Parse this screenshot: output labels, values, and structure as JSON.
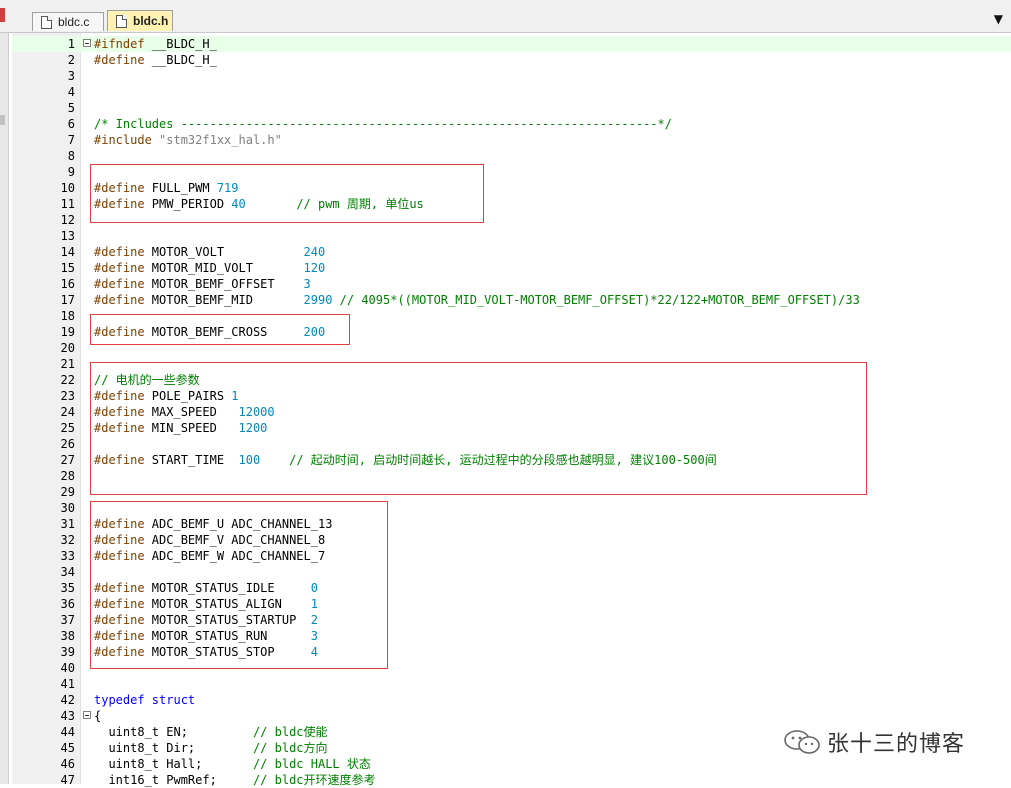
{
  "tabs": [
    {
      "label": "bldc.c",
      "active": false
    },
    {
      "label": "bldc.h",
      "active": true
    }
  ],
  "dropdown_glyph": "▼",
  "lines": [
    {
      "n": "1",
      "fold": true,
      "cur": true,
      "parts": [
        [
          "pp",
          "#ifndef "
        ],
        [
          "tp",
          "__BLDC_H_"
        ]
      ]
    },
    {
      "n": "2",
      "parts": [
        [
          "pp",
          "#define "
        ],
        [
          "tp",
          "__BLDC_H_"
        ]
      ]
    },
    {
      "n": "3",
      "parts": []
    },
    {
      "n": "4",
      "parts": []
    },
    {
      "n": "5",
      "parts": []
    },
    {
      "n": "6",
      "parts": [
        [
          "cm",
          "/* Includes ------------------------------------------------------------------*/"
        ]
      ]
    },
    {
      "n": "7",
      "parts": [
        [
          "pp",
          "#include "
        ],
        [
          "st",
          "\"stm32f1xx_hal.h\""
        ]
      ]
    },
    {
      "n": "8",
      "parts": []
    },
    {
      "n": "9",
      "parts": []
    },
    {
      "n": "10",
      "parts": [
        [
          "pp",
          "#define "
        ],
        [
          "tp",
          "FULL_PWM "
        ],
        [
          "nm",
          "719"
        ]
      ]
    },
    {
      "n": "11",
      "parts": [
        [
          "pp",
          "#define "
        ],
        [
          "tp",
          "PMW_PERIOD "
        ],
        [
          "nm",
          "40"
        ],
        [
          "tp",
          "       "
        ],
        [
          "cm",
          "// pwm 周期, 单位us"
        ]
      ]
    },
    {
      "n": "12",
      "parts": []
    },
    {
      "n": "13",
      "parts": []
    },
    {
      "n": "14",
      "parts": [
        [
          "pp",
          "#define "
        ],
        [
          "tp",
          "MOTOR_VOLT           "
        ],
        [
          "nm",
          "240"
        ]
      ]
    },
    {
      "n": "15",
      "parts": [
        [
          "pp",
          "#define "
        ],
        [
          "tp",
          "MOTOR_MID_VOLT       "
        ],
        [
          "nm",
          "120"
        ]
      ]
    },
    {
      "n": "16",
      "parts": [
        [
          "pp",
          "#define "
        ],
        [
          "tp",
          "MOTOR_BEMF_OFFSET    "
        ],
        [
          "nm",
          "3"
        ]
      ]
    },
    {
      "n": "17",
      "parts": [
        [
          "pp",
          "#define "
        ],
        [
          "tp",
          "MOTOR_BEMF_MID       "
        ],
        [
          "nm",
          "2990"
        ],
        [
          "cm",
          " // 4095*((MOTOR_MID_VOLT-MOTOR_BEMF_OFFSET)*22/122+MOTOR_BEMF_OFFSET)/33"
        ]
      ]
    },
    {
      "n": "18",
      "parts": []
    },
    {
      "n": "19",
      "parts": [
        [
          "pp",
          "#define "
        ],
        [
          "tp",
          "MOTOR_BEMF_CROSS     "
        ],
        [
          "nm",
          "200"
        ]
      ]
    },
    {
      "n": "20",
      "parts": []
    },
    {
      "n": "21",
      "parts": []
    },
    {
      "n": "22",
      "parts": [
        [
          "cm",
          "// 电机的一些参数"
        ]
      ]
    },
    {
      "n": "23",
      "parts": [
        [
          "pp",
          "#define "
        ],
        [
          "tp",
          "POLE_PAIRS "
        ],
        [
          "nm",
          "1"
        ]
      ]
    },
    {
      "n": "24",
      "parts": [
        [
          "pp",
          "#define "
        ],
        [
          "tp",
          "MAX_SPEED   "
        ],
        [
          "nm",
          "12000"
        ]
      ]
    },
    {
      "n": "25",
      "parts": [
        [
          "pp",
          "#define "
        ],
        [
          "tp",
          "MIN_SPEED   "
        ],
        [
          "nm",
          "1200"
        ]
      ]
    },
    {
      "n": "26",
      "parts": []
    },
    {
      "n": "27",
      "parts": [
        [
          "pp",
          "#define "
        ],
        [
          "tp",
          "START_TIME  "
        ],
        [
          "nm",
          "100"
        ],
        [
          "tp",
          "    "
        ],
        [
          "cm",
          "// 起动时间, 启动时间越长, 运动过程中的分段感也越明显, 建议100-500间"
        ]
      ]
    },
    {
      "n": "28",
      "parts": []
    },
    {
      "n": "29",
      "parts": []
    },
    {
      "n": "30",
      "parts": []
    },
    {
      "n": "31",
      "parts": [
        [
          "pp",
          "#define "
        ],
        [
          "tp",
          "ADC_BEMF_U ADC_CHANNEL_13"
        ]
      ]
    },
    {
      "n": "32",
      "parts": [
        [
          "pp",
          "#define "
        ],
        [
          "tp",
          "ADC_BEMF_V ADC_CHANNEL_8"
        ]
      ]
    },
    {
      "n": "33",
      "parts": [
        [
          "pp",
          "#define "
        ],
        [
          "tp",
          "ADC_BEMF_W ADC_CHANNEL_7"
        ]
      ]
    },
    {
      "n": "34",
      "parts": []
    },
    {
      "n": "35",
      "parts": [
        [
          "pp",
          "#define "
        ],
        [
          "tp",
          "MOTOR_STATUS_IDLE     "
        ],
        [
          "nm",
          "0"
        ]
      ]
    },
    {
      "n": "36",
      "parts": [
        [
          "pp",
          "#define "
        ],
        [
          "tp",
          "MOTOR_STATUS_ALIGN    "
        ],
        [
          "nm",
          "1"
        ]
      ]
    },
    {
      "n": "37",
      "parts": [
        [
          "pp",
          "#define "
        ],
        [
          "tp",
          "MOTOR_STATUS_STARTUP  "
        ],
        [
          "nm",
          "2"
        ]
      ]
    },
    {
      "n": "38",
      "parts": [
        [
          "pp",
          "#define "
        ],
        [
          "tp",
          "MOTOR_STATUS_RUN      "
        ],
        [
          "nm",
          "3"
        ]
      ]
    },
    {
      "n": "39",
      "parts": [
        [
          "pp",
          "#define "
        ],
        [
          "tp",
          "MOTOR_STATUS_STOP     "
        ],
        [
          "nm",
          "4"
        ]
      ]
    },
    {
      "n": "40",
      "parts": []
    },
    {
      "n": "41",
      "parts": []
    },
    {
      "n": "42",
      "parts": [
        [
          "kw",
          "typedef struct"
        ]
      ]
    },
    {
      "n": "43",
      "fold": true,
      "parts": [
        [
          "tp",
          "{"
        ]
      ]
    },
    {
      "n": "44",
      "parts": [
        [
          "tp",
          "  uint8_t EN;         "
        ],
        [
          "cm",
          "// bldc使能"
        ]
      ]
    },
    {
      "n": "45",
      "parts": [
        [
          "tp",
          "  uint8_t Dir;        "
        ],
        [
          "cm",
          "// bldc方向"
        ]
      ]
    },
    {
      "n": "46",
      "parts": [
        [
          "tp",
          "  uint8_t Hall;       "
        ],
        [
          "cm",
          "// bldc HALL 状态"
        ]
      ]
    },
    {
      "n": "47",
      "parts": [
        [
          "tp",
          "  int16_t PwmRef;     "
        ],
        [
          "cm",
          "// bldc开环速度参考"
        ]
      ]
    }
  ],
  "watermark": {
    "text": "张十三的博客",
    "icon": "wechat-icon",
    "color": "#333333"
  },
  "colors": {
    "preprocessor": "#804000",
    "comment": "#008000",
    "number": "#0088c0",
    "string": "#808080",
    "keyword": "#0000ff",
    "highlight_box": "#e04040",
    "current_line": "#e8ffe8"
  }
}
